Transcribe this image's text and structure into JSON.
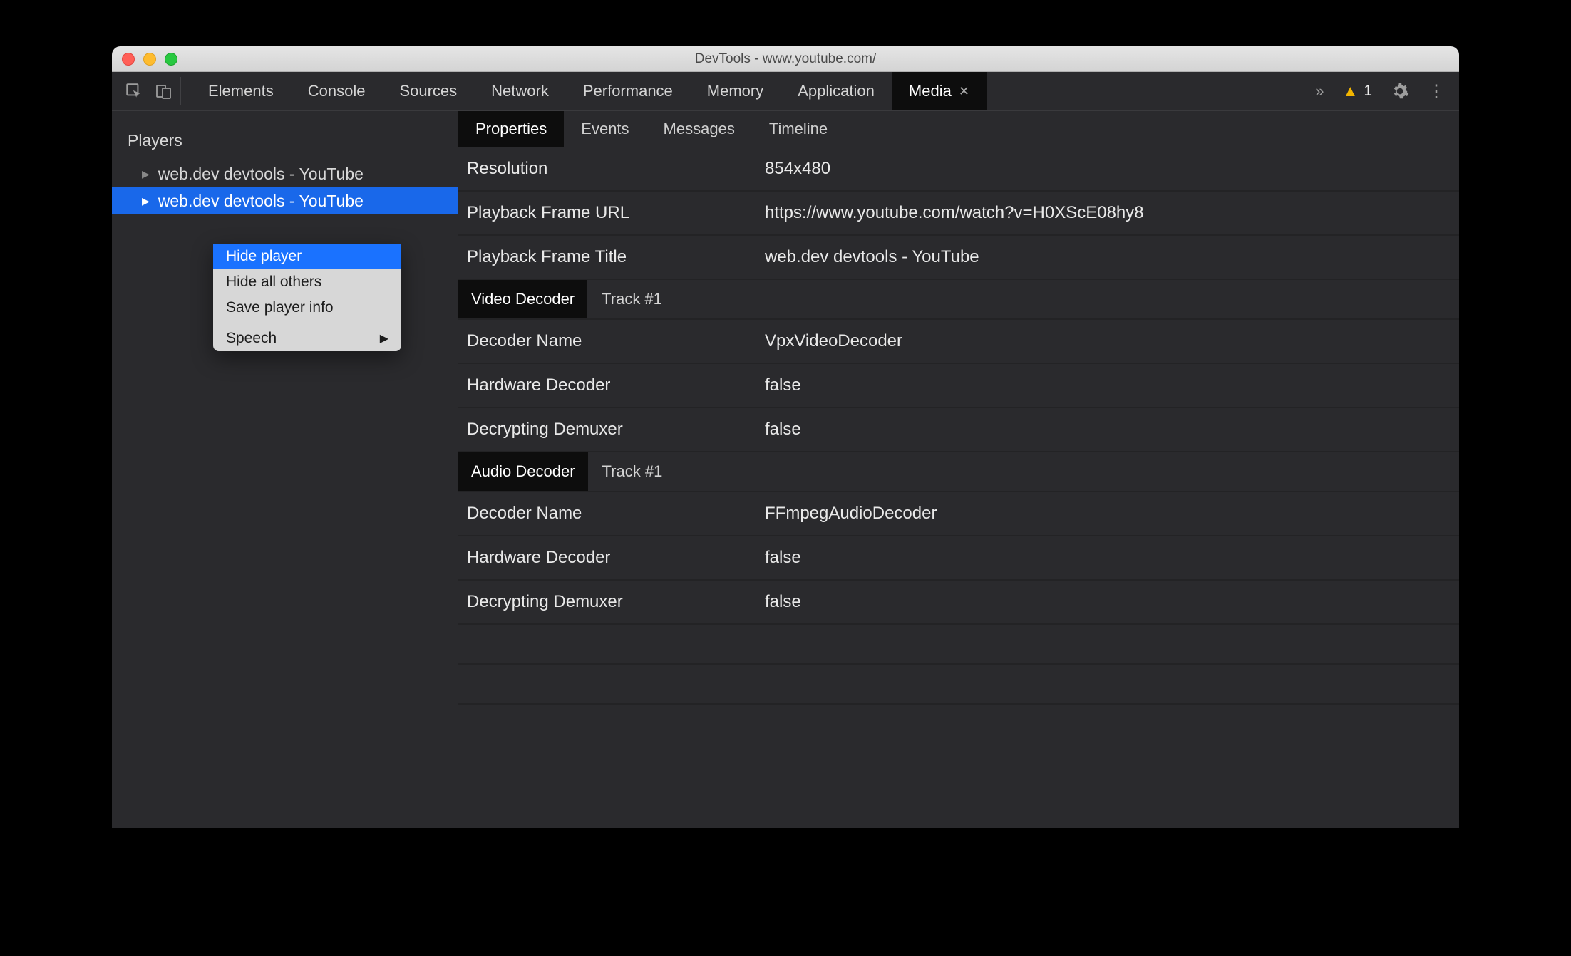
{
  "window": {
    "title": "DevTools - www.youtube.com/"
  },
  "toolbar": {
    "tabs": [
      "Elements",
      "Console",
      "Sources",
      "Network",
      "Performance",
      "Memory",
      "Application",
      "Media"
    ],
    "active_tab": "Media",
    "warnings": "1"
  },
  "sidebar": {
    "title": "Players",
    "players": [
      {
        "label": "web.dev devtools - YouTube",
        "selected": false
      },
      {
        "label": "web.dev devtools - YouTube",
        "selected": true
      }
    ]
  },
  "context_menu": {
    "items": [
      {
        "label": "Hide player",
        "selected": true
      },
      {
        "label": "Hide all others",
        "selected": false
      },
      {
        "label": "Save player info",
        "selected": false
      }
    ],
    "submenu_label": "Speech"
  },
  "subtabs": {
    "items": [
      "Properties",
      "Events",
      "Messages",
      "Timeline"
    ],
    "active": "Properties"
  },
  "properties": {
    "general": [
      {
        "label": "Resolution",
        "value": "854x480"
      },
      {
        "label": "Playback Frame URL",
        "value": "https://www.youtube.com/watch?v=H0XScE08hy8"
      },
      {
        "label": "Playback Frame Title",
        "value": "web.dev devtools - YouTube"
      }
    ],
    "video_section": {
      "title": "Video Decoder",
      "track": "Track #1"
    },
    "video": [
      {
        "label": "Decoder Name",
        "value": "VpxVideoDecoder"
      },
      {
        "label": "Hardware Decoder",
        "value": "false"
      },
      {
        "label": "Decrypting Demuxer",
        "value": "false"
      }
    ],
    "audio_section": {
      "title": "Audio Decoder",
      "track": "Track #1"
    },
    "audio": [
      {
        "label": "Decoder Name",
        "value": "FFmpegAudioDecoder"
      },
      {
        "label": "Hardware Decoder",
        "value": "false"
      },
      {
        "label": "Decrypting Demuxer",
        "value": "false"
      }
    ]
  }
}
